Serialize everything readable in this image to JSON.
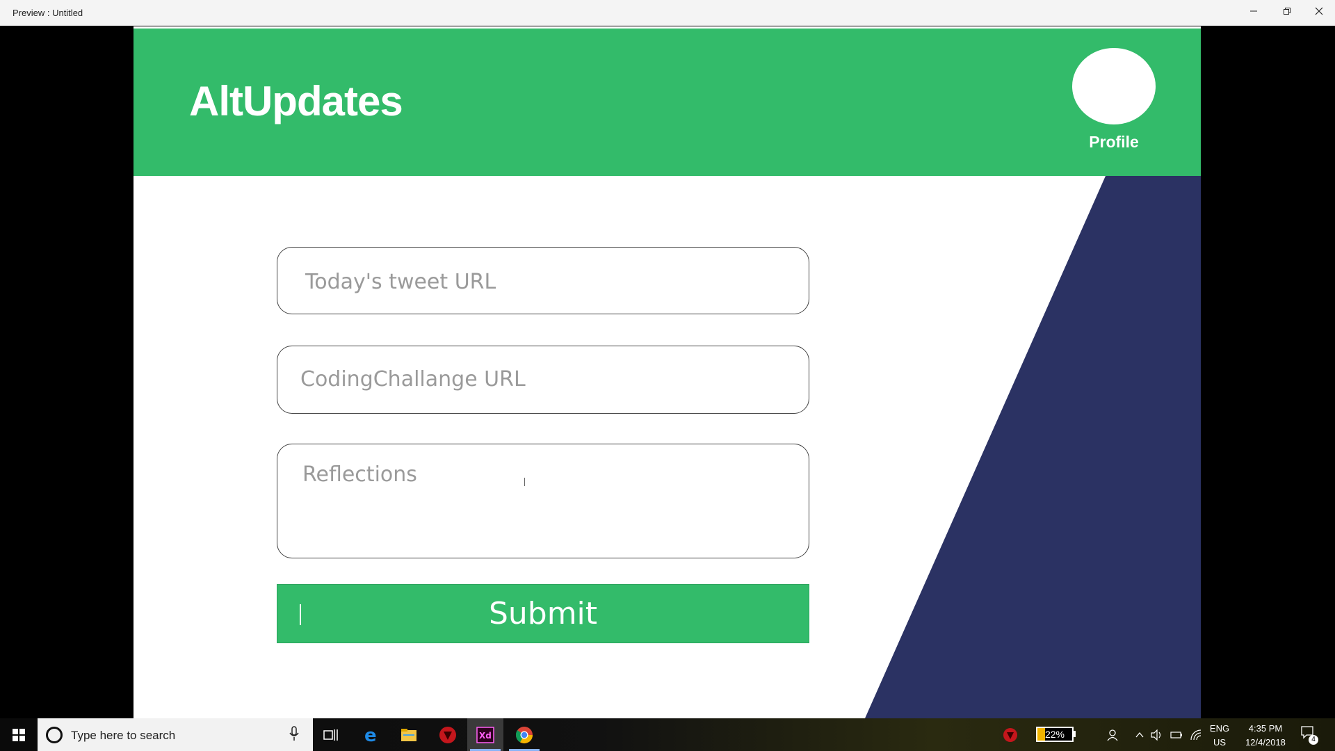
{
  "window": {
    "title": "Preview : Untitled",
    "minimize_icon": "minimize-icon",
    "maximize_icon": "restore-icon",
    "close_icon": "close-icon"
  },
  "header": {
    "brand": "AltUpdates",
    "profile_label": "Profile"
  },
  "form": {
    "tweet_placeholder": "Today's tweet URL",
    "coding_placeholder": "CodingChallange URL",
    "reflections_placeholder": "Reflections",
    "submit_label": "Submit"
  },
  "colors": {
    "accent_green": "#33bb6a",
    "navy": "#2b3263",
    "background": "#ffffff"
  },
  "taskbar": {
    "search_placeholder": "Type here to search",
    "apps": [
      "task-view-icon",
      "edge-icon",
      "file-explorer-icon",
      "app-red-icon",
      "adobe-xd-icon",
      "chrome-icon"
    ],
    "battery": "22%",
    "lang_line1": "ENG",
    "lang_line2": "US",
    "time": "4:35 PM",
    "date": "12/4/2018",
    "notifications": "4"
  }
}
